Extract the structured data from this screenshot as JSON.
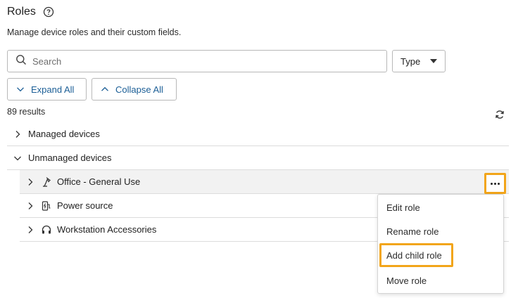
{
  "header": {
    "title": "Roles",
    "subtitle": "Manage device roles and their custom fields."
  },
  "icons": {
    "help": "help-circle-icon",
    "search": "search-icon",
    "refresh": "refresh-icon",
    "more": "more-horizontal-icon"
  },
  "filters": {
    "search_placeholder": "Search",
    "search_value": "",
    "type_label": "Type"
  },
  "actions": {
    "expand_all": "Expand All",
    "collapse_all": "Collapse All"
  },
  "results": {
    "count_label": "89 results"
  },
  "tree": {
    "groups": [
      {
        "label": "Managed devices",
        "expanded": false
      },
      {
        "label": "Unmanaged devices",
        "expanded": true
      }
    ],
    "children": [
      {
        "label": "Office - General Use",
        "icon": "desk-lamp-icon"
      },
      {
        "label": "Power source",
        "icon": "power-source-icon"
      },
      {
        "label": "Workstation Accessories",
        "icon": "headset-icon"
      }
    ]
  },
  "context_menu": {
    "items": [
      {
        "label": "Edit role"
      },
      {
        "label": "Rename role"
      },
      {
        "label": "Add child role"
      },
      {
        "label": "Move role"
      }
    ]
  },
  "colors": {
    "accent": "#1b5e96",
    "highlight": "#f2a51a",
    "selected_row": "#f2f2f2",
    "border": "#b8b8b8"
  }
}
